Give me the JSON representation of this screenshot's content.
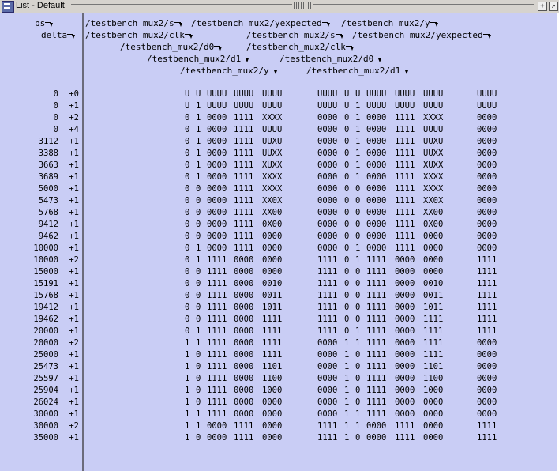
{
  "window": {
    "title": "List - Default"
  },
  "icons": {
    "app": "list-window-icon",
    "add": "plus-icon",
    "undock": "undock-icon"
  },
  "time_headers": {
    "ps": "ps",
    "delta": "delta"
  },
  "signal_headers": [
    "/testbench_mux2/s",
    "/testbench_mux2/yexpected",
    "/testbench_mux2/y",
    "/testbench_mux2/clk",
    "/testbench_mux2/s",
    "/testbench_mux2/yexpected",
    "/testbench_mux2/d0",
    "/testbench_mux2/clk",
    "/testbench_mux2/d1",
    "/testbench_mux2/d0",
    "/testbench_mux2/y",
    "/testbench_mux2/d1"
  ],
  "columns": {
    "group1": [
      "clk",
      "s",
      "d0",
      "d1",
      "y"
    ],
    "group2": [
      "yexpected",
      "s",
      "clk",
      "d0",
      "d1",
      "y"
    ],
    "group3": [
      "yexpected"
    ]
  },
  "rows": [
    {
      "t": "0",
      "d": "+0",
      "g1": [
        "U",
        "U",
        "UUUU",
        "UUUU",
        "UUUU"
      ],
      "g2": [
        "UUUU",
        "U",
        "U",
        "UUUU",
        "UUUU",
        "UUUU"
      ],
      "g3": "UUUU"
    },
    {
      "t": "0",
      "d": "+1",
      "g1": [
        "U",
        "1",
        "UUUU",
        "UUUU",
        "UUUU"
      ],
      "g2": [
        "UUUU",
        "U",
        "1",
        "UUUU",
        "UUUU",
        "UUUU"
      ],
      "g3": "UUUU"
    },
    {
      "t": "0",
      "d": "+2",
      "g1": [
        "0",
        "1",
        "0000",
        "1111",
        "XXXX"
      ],
      "g2": [
        "0000",
        "0",
        "1",
        "0000",
        "1111",
        "XXXX"
      ],
      "g3": "0000"
    },
    {
      "t": "0",
      "d": "+4",
      "g1": [
        "0",
        "1",
        "0000",
        "1111",
        "UUUU"
      ],
      "g2": [
        "0000",
        "0",
        "1",
        "0000",
        "1111",
        "UUUU"
      ],
      "g3": "0000"
    },
    {
      "t": "3112",
      "d": "+1",
      "g1": [
        "0",
        "1",
        "0000",
        "1111",
        "UUXU"
      ],
      "g2": [
        "0000",
        "0",
        "1",
        "0000",
        "1111",
        "UUXU"
      ],
      "g3": "0000"
    },
    {
      "t": "3388",
      "d": "+1",
      "g1": [
        "0",
        "1",
        "0000",
        "1111",
        "UUXX"
      ],
      "g2": [
        "0000",
        "0",
        "1",
        "0000",
        "1111",
        "UUXX"
      ],
      "g3": "0000"
    },
    {
      "t": "3663",
      "d": "+1",
      "g1": [
        "0",
        "1",
        "0000",
        "1111",
        "XUXX"
      ],
      "g2": [
        "0000",
        "0",
        "1",
        "0000",
        "1111",
        "XUXX"
      ],
      "g3": "0000"
    },
    {
      "t": "3689",
      "d": "+1",
      "g1": [
        "0",
        "1",
        "0000",
        "1111",
        "XXXX"
      ],
      "g2": [
        "0000",
        "0",
        "1",
        "0000",
        "1111",
        "XXXX"
      ],
      "g3": "0000"
    },
    {
      "t": "5000",
      "d": "+1",
      "g1": [
        "0",
        "0",
        "0000",
        "1111",
        "XXXX"
      ],
      "g2": [
        "0000",
        "0",
        "0",
        "0000",
        "1111",
        "XXXX"
      ],
      "g3": "0000"
    },
    {
      "t": "5473",
      "d": "+1",
      "g1": [
        "0",
        "0",
        "0000",
        "1111",
        "XX0X"
      ],
      "g2": [
        "0000",
        "0",
        "0",
        "0000",
        "1111",
        "XX0X"
      ],
      "g3": "0000"
    },
    {
      "t": "5768",
      "d": "+1",
      "g1": [
        "0",
        "0",
        "0000",
        "1111",
        "XX00"
      ],
      "g2": [
        "0000",
        "0",
        "0",
        "0000",
        "1111",
        "XX00"
      ],
      "g3": "0000"
    },
    {
      "t": "9412",
      "d": "+1",
      "g1": [
        "0",
        "0",
        "0000",
        "1111",
        "0X00"
      ],
      "g2": [
        "0000",
        "0",
        "0",
        "0000",
        "1111",
        "0X00"
      ],
      "g3": "0000"
    },
    {
      "t": "9462",
      "d": "+1",
      "g1": [
        "0",
        "0",
        "0000",
        "1111",
        "0000"
      ],
      "g2": [
        "0000",
        "0",
        "0",
        "0000",
        "1111",
        "0000"
      ],
      "g3": "0000"
    },
    {
      "t": "10000",
      "d": "+1",
      "g1": [
        "0",
        "1",
        "0000",
        "1111",
        "0000"
      ],
      "g2": [
        "0000",
        "0",
        "1",
        "0000",
        "1111",
        "0000"
      ],
      "g3": "0000"
    },
    {
      "t": "10000",
      "d": "+2",
      "g1": [
        "0",
        "1",
        "1111",
        "0000",
        "0000"
      ],
      "g2": [
        "1111",
        "0",
        "1",
        "1111",
        "0000",
        "0000"
      ],
      "g3": "1111"
    },
    {
      "t": "15000",
      "d": "+1",
      "g1": [
        "0",
        "0",
        "1111",
        "0000",
        "0000"
      ],
      "g2": [
        "1111",
        "0",
        "0",
        "1111",
        "0000",
        "0000"
      ],
      "g3": "1111"
    },
    {
      "t": "15191",
      "d": "+1",
      "g1": [
        "0",
        "0",
        "1111",
        "0000",
        "0010"
      ],
      "g2": [
        "1111",
        "0",
        "0",
        "1111",
        "0000",
        "0010"
      ],
      "g3": "1111"
    },
    {
      "t": "15768",
      "d": "+1",
      "g1": [
        "0",
        "0",
        "1111",
        "0000",
        "0011"
      ],
      "g2": [
        "1111",
        "0",
        "0",
        "1111",
        "0000",
        "0011"
      ],
      "g3": "1111"
    },
    {
      "t": "19412",
      "d": "+1",
      "g1": [
        "0",
        "0",
        "1111",
        "0000",
        "1011"
      ],
      "g2": [
        "1111",
        "0",
        "0",
        "1111",
        "0000",
        "1011"
      ],
      "g3": "1111"
    },
    {
      "t": "19462",
      "d": "+1",
      "g1": [
        "0",
        "0",
        "1111",
        "0000",
        "1111"
      ],
      "g2": [
        "1111",
        "0",
        "0",
        "1111",
        "0000",
        "1111"
      ],
      "g3": "1111"
    },
    {
      "t": "20000",
      "d": "+1",
      "g1": [
        "0",
        "1",
        "1111",
        "0000",
        "1111"
      ],
      "g2": [
        "1111",
        "0",
        "1",
        "1111",
        "0000",
        "1111"
      ],
      "g3": "1111"
    },
    {
      "t": "20000",
      "d": "+2",
      "g1": [
        "1",
        "1",
        "1111",
        "0000",
        "1111"
      ],
      "g2": [
        "0000",
        "1",
        "1",
        "1111",
        "0000",
        "1111"
      ],
      "g3": "0000"
    },
    {
      "t": "25000",
      "d": "+1",
      "g1": [
        "1",
        "0",
        "1111",
        "0000",
        "1111"
      ],
      "g2": [
        "0000",
        "1",
        "0",
        "1111",
        "0000",
        "1111"
      ],
      "g3": "0000"
    },
    {
      "t": "25473",
      "d": "+1",
      "g1": [
        "1",
        "0",
        "1111",
        "0000",
        "1101"
      ],
      "g2": [
        "0000",
        "1",
        "0",
        "1111",
        "0000",
        "1101"
      ],
      "g3": "0000"
    },
    {
      "t": "25597",
      "d": "+1",
      "g1": [
        "1",
        "0",
        "1111",
        "0000",
        "1100"
      ],
      "g2": [
        "0000",
        "1",
        "0",
        "1111",
        "0000",
        "1100"
      ],
      "g3": "0000"
    },
    {
      "t": "25904",
      "d": "+1",
      "g1": [
        "1",
        "0",
        "1111",
        "0000",
        "1000"
      ],
      "g2": [
        "0000",
        "1",
        "0",
        "1111",
        "0000",
        "1000"
      ],
      "g3": "0000"
    },
    {
      "t": "26024",
      "d": "+1",
      "g1": [
        "1",
        "0",
        "1111",
        "0000",
        "0000"
      ],
      "g2": [
        "0000",
        "1",
        "0",
        "1111",
        "0000",
        "0000"
      ],
      "g3": "0000"
    },
    {
      "t": "30000",
      "d": "+1",
      "g1": [
        "1",
        "1",
        "1111",
        "0000",
        "0000"
      ],
      "g2": [
        "0000",
        "1",
        "1",
        "1111",
        "0000",
        "0000"
      ],
      "g3": "0000"
    },
    {
      "t": "30000",
      "d": "+2",
      "g1": [
        "1",
        "1",
        "0000",
        "1111",
        "0000"
      ],
      "g2": [
        "1111",
        "1",
        "1",
        "0000",
        "1111",
        "0000"
      ],
      "g3": "1111"
    },
    {
      "t": "35000",
      "d": "+1",
      "g1": [
        "1",
        "0",
        "0000",
        "1111",
        "0000"
      ],
      "g2": [
        "1111",
        "1",
        "0",
        "0000",
        "1111",
        "0000"
      ],
      "g3": "1111"
    }
  ]
}
